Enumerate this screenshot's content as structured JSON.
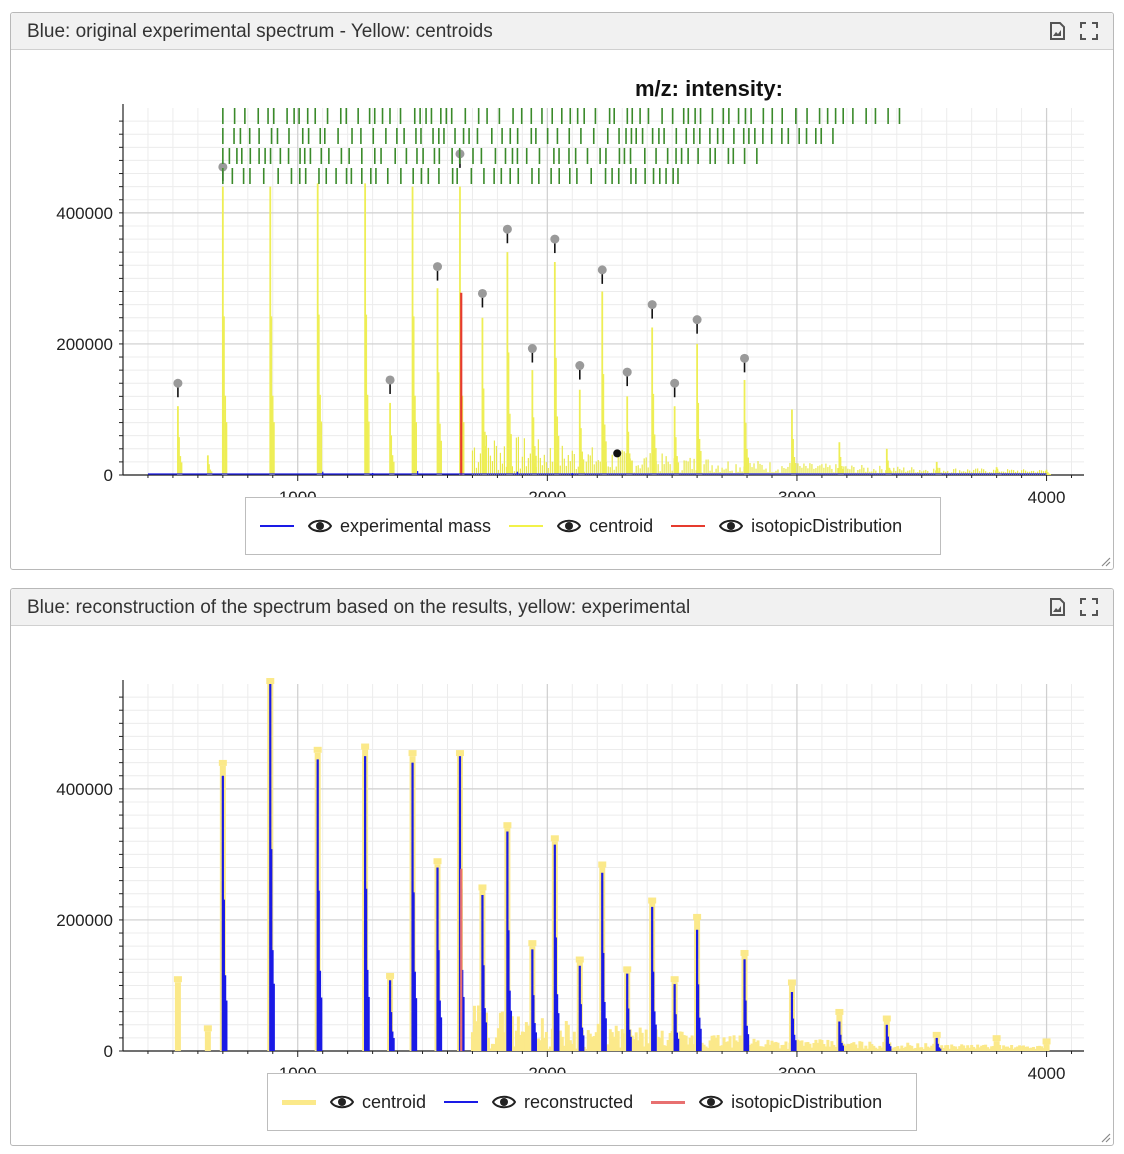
{
  "panels": [
    {
      "title": "Blue: original experimental spectrum - Yellow: centroids",
      "readout_label": "m/z: intensity:",
      "legend": [
        {
          "label": "experimental mass",
          "color": "#1a1ae6",
          "icon": "eye-icon"
        },
        {
          "label": "centroid",
          "color": "#f2f24a",
          "icon": "eye-icon"
        },
        {
          "label": "isotopicDistribution",
          "color": "#e63b2e",
          "icon": "eye-icon"
        }
      ]
    },
    {
      "title": "Blue: reconstruction of the spectrum based on the results, yellow: experimental",
      "legend": [
        {
          "label": "centroid",
          "color": "#fbe98a",
          "icon": "eye-icon"
        },
        {
          "label": "reconstructed",
          "color": "#1a1ae6",
          "icon": "eye-icon"
        },
        {
          "label": "isotopicDistribution",
          "color": "#e87070",
          "icon": "eye-icon"
        }
      ]
    }
  ],
  "header_icons": [
    "export-image-icon",
    "fullscreen-icon"
  ],
  "chart_data": [
    {
      "type": "line",
      "xlim": [
        300,
        4150
      ],
      "ylim": [
        0,
        560000
      ],
      "xticks": [
        1000,
        2000,
        3000,
        4000
      ],
      "yticks": [
        0,
        200000,
        400000
      ],
      "grid": true,
      "legend_position": "bottom",
      "series": [
        {
          "name": "experimental mass",
          "peaks": [
            [
              520,
              4000
            ],
            [
              700,
              8000
            ],
            [
              900,
              6000
            ],
            [
              1100,
              5000
            ],
            [
              1300,
              3000
            ],
            [
              1480,
              6000
            ],
            [
              1660,
              4000
            ],
            [
              1880,
              5000
            ],
            [
              2100,
              3000
            ]
          ]
        },
        {
          "name": "centroid",
          "peaks": [
            [
              520,
              105000
            ],
            [
              640,
              30000
            ],
            [
              700,
              440000
            ],
            [
              890,
              440000
            ],
            [
              1080,
              445000
            ],
            [
              1270,
              445000
            ],
            [
              1370,
              110000
            ],
            [
              1460,
              440000
            ],
            [
              1560,
              285000
            ],
            [
              1650,
              440000
            ],
            [
              1740,
              240000
            ],
            [
              1840,
              340000
            ],
            [
              1940,
              160000
            ],
            [
              2030,
              325000
            ],
            [
              2130,
              130000
            ],
            [
              2220,
              280000
            ],
            [
              2320,
              120000
            ],
            [
              2420,
              225000
            ],
            [
              2510,
              105000
            ],
            [
              2600,
              200000
            ],
            [
              2790,
              145000
            ],
            [
              2980,
              100000
            ],
            [
              3170,
              50000
            ],
            [
              3360,
              40000
            ],
            [
              3560,
              20000
            ],
            [
              3800,
              12000
            ],
            [
              4000,
              8000
            ]
          ]
        },
        {
          "name": "isotopicDistribution",
          "peaks": [
            [
              1655,
              278000
            ]
          ]
        }
      ],
      "markers": [
        [
          520,
          140000
        ],
        [
          700,
          470000
        ],
        [
          1370,
          145000
        ],
        [
          1560,
          318000
        ],
        [
          1650,
          490000
        ],
        [
          1740,
          277000
        ],
        [
          1840,
          375000
        ],
        [
          1940,
          193000
        ],
        [
          2030,
          360000
        ],
        [
          2130,
          167000
        ],
        [
          2220,
          313000
        ],
        [
          2320,
          157000
        ],
        [
          2420,
          260000
        ],
        [
          2510,
          140000
        ],
        [
          2600,
          237000
        ],
        [
          2790,
          178000
        ]
      ],
      "cursor_point": [
        2280,
        33000
      ]
    },
    {
      "type": "line",
      "xlim": [
        300,
        4150
      ],
      "ylim": [
        0,
        560000
      ],
      "xticks": [
        1000,
        2000,
        3000,
        4000
      ],
      "yticks": [
        0,
        200000,
        400000
      ],
      "grid": true,
      "legend_position": "bottom",
      "series": [
        {
          "name": "centroid",
          "peaks": [
            [
              520,
              105000
            ],
            [
              640,
              30000
            ],
            [
              700,
              435000
            ],
            [
              890,
              560000
            ],
            [
              1080,
              455000
            ],
            [
              1270,
              460000
            ],
            [
              1370,
              110000
            ],
            [
              1460,
              450000
            ],
            [
              1560,
              285000
            ],
            [
              1650,
              450000
            ],
            [
              1740,
              245000
            ],
            [
              1840,
              340000
            ],
            [
              1940,
              160000
            ],
            [
              2030,
              320000
            ],
            [
              2130,
              135000
            ],
            [
              2220,
              280000
            ],
            [
              2320,
              120000
            ],
            [
              2420,
              225000
            ],
            [
              2510,
              105000
            ],
            [
              2600,
              200000
            ],
            [
              2790,
              145000
            ],
            [
              2980,
              100000
            ],
            [
              3170,
              55000
            ],
            [
              3360,
              45000
            ],
            [
              3560,
              20000
            ],
            [
              3800,
              15000
            ],
            [
              4000,
              10000
            ]
          ]
        },
        {
          "name": "reconstructed",
          "peaks": [
            [
              700,
              420000
            ],
            [
              890,
              560000
            ],
            [
              1080,
              445000
            ],
            [
              1270,
              450000
            ],
            [
              1370,
              108000
            ],
            [
              1460,
              440000
            ],
            [
              1560,
              280000
            ],
            [
              1650,
              450000
            ],
            [
              1740,
              238000
            ],
            [
              1840,
              335000
            ],
            [
              1940,
              155000
            ],
            [
              2030,
              315000
            ],
            [
              2130,
              130000
            ],
            [
              2220,
              272000
            ],
            [
              2320,
              118000
            ],
            [
              2420,
              220000
            ],
            [
              2510,
              102000
            ],
            [
              2600,
              185000
            ],
            [
              2790,
              140000
            ],
            [
              2980,
              90000
            ],
            [
              3170,
              45000
            ],
            [
              3360,
              40000
            ],
            [
              3560,
              20000
            ]
          ]
        },
        {
          "name": "isotopicDistribution",
          "peaks": [
            [
              1655,
              278000
            ]
          ]
        }
      ]
    }
  ]
}
